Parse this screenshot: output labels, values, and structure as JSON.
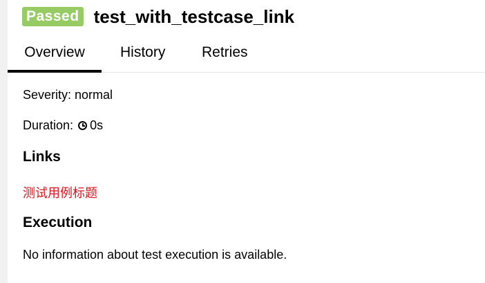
{
  "status": {
    "label": "Passed",
    "color": "#97cc64"
  },
  "test": {
    "title": "test_with_testcase_link"
  },
  "tabs": [
    {
      "label": "Overview",
      "active": true
    },
    {
      "label": "History",
      "active": false
    },
    {
      "label": "Retries",
      "active": false
    }
  ],
  "overview": {
    "severity_text": "Severity: normal",
    "duration_label": "Duration:",
    "duration_icon": "clock-icon",
    "duration_value": "0s",
    "links_heading": "Links",
    "links": [
      {
        "text": "测试用例标题",
        "color": "#e0141d"
      }
    ],
    "execution_heading": "Execution",
    "execution_text": "No information about test execution is available."
  }
}
